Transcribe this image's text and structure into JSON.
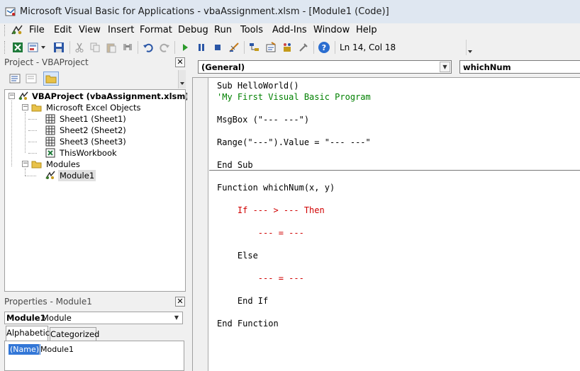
{
  "window": {
    "title": "Microsoft Visual Basic for Applications - vbaAssignment.xlsm - [Module1 (Code)]"
  },
  "menu": {
    "items": [
      {
        "label": "File"
      },
      {
        "label": "Edit"
      },
      {
        "label": "View"
      },
      {
        "label": "Insert"
      },
      {
        "label": "Format"
      },
      {
        "label": "Debug"
      },
      {
        "label": "Run"
      },
      {
        "label": "Tools"
      },
      {
        "label": "Add-Ins"
      },
      {
        "label": "Window"
      },
      {
        "label": "Help"
      }
    ]
  },
  "toolbar": {
    "status": "Ln 14, Col 18",
    "buttons": [
      "excel-icon",
      "insert-module-icon",
      "save-icon",
      "cut-icon",
      "copy-icon",
      "paste-icon",
      "find-icon",
      "undo-icon",
      "redo-icon",
      "run-icon",
      "break-icon",
      "reset-icon",
      "design-mode-icon",
      "project-explorer-icon",
      "properties-window-icon",
      "object-browser-icon",
      "toolbox-icon",
      "help-icon"
    ]
  },
  "project_panel": {
    "title": "Project - VBAProject",
    "close": "✕",
    "tree": {
      "root": "VBAProject (vbaAssignment.xlsm)",
      "excel_objects": "Microsoft Excel Objects",
      "sheets": [
        {
          "label": "Sheet1 (Sheet1)"
        },
        {
          "label": "Sheet2 (Sheet2)"
        },
        {
          "label": "Sheet3 (Sheet3)"
        }
      ],
      "workbook": "ThisWorkbook",
      "modules_folder": "Modules",
      "module": "Module1"
    }
  },
  "properties_panel": {
    "title": "Properties - Module1",
    "close": "✕",
    "object_name": "Module1",
    "object_type": "Module",
    "tabs": {
      "alphabetic": "Alphabetic",
      "categorized": "Categorized"
    },
    "row": {
      "name": "(Name)",
      "value": "Module1"
    }
  },
  "code_window": {
    "object_combo": "(General)",
    "procedure_combo": "whichNum",
    "lines": [
      {
        "text": "Sub HelloWorld()",
        "style": "normal"
      },
      {
        "text": "'My First Visual Basic Program",
        "style": "comment"
      },
      {
        "text": "",
        "style": "normal"
      },
      {
        "text": "MsgBox (\"--- ---\")",
        "style": "normal"
      },
      {
        "text": "",
        "style": "normal"
      },
      {
        "text": "Range(\"---\").Value = \"--- ---\"",
        "style": "normal"
      },
      {
        "text": "",
        "style": "normal"
      },
      {
        "text": "End Sub",
        "style": "normal"
      },
      {
        "text": "",
        "style": "normal"
      },
      {
        "text": "Function whichNum(x, y)",
        "style": "normal"
      },
      {
        "text": "",
        "style": "normal"
      },
      {
        "text": "    If --- > --- Then",
        "style": "red"
      },
      {
        "text": "",
        "style": "normal"
      },
      {
        "text": "        --- = ---",
        "style": "red"
      },
      {
        "text": "",
        "style": "normal"
      },
      {
        "text": "    Else",
        "style": "normal"
      },
      {
        "text": "",
        "style": "normal"
      },
      {
        "text": "        --- = ---",
        "style": "red"
      },
      {
        "text": "",
        "style": "normal"
      },
      {
        "text": "    End If",
        "style": "normal"
      },
      {
        "text": "",
        "style": "normal"
      },
      {
        "text": "End Function",
        "style": "normal"
      }
    ]
  }
}
